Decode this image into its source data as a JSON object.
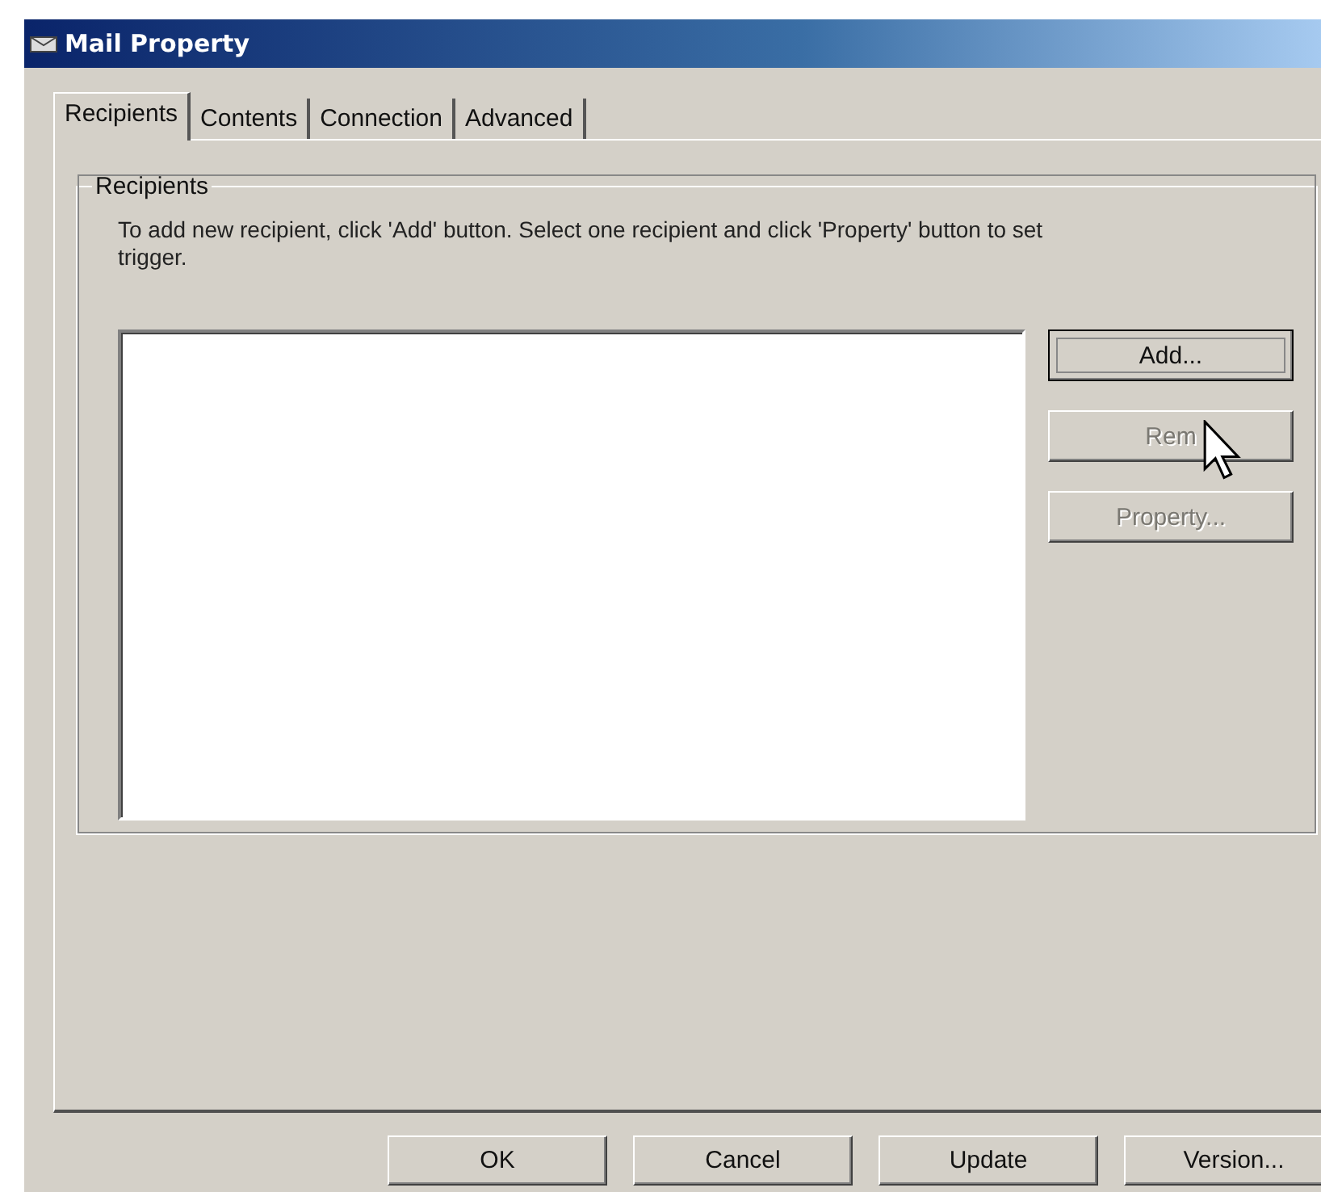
{
  "window": {
    "title": "Mail Property"
  },
  "tabs": [
    {
      "label": "Recipients",
      "selected": true
    },
    {
      "label": "Contents",
      "selected": false
    },
    {
      "label": "Connection",
      "selected": false
    },
    {
      "label": "Advanced",
      "selected": false
    }
  ],
  "group": {
    "title": "Recipients",
    "instructions": "To add new recipient, click 'Add' button. Select one recipient and click 'Property' button to set trigger."
  },
  "side_buttons": [
    {
      "label": "Add...",
      "disabled": false,
      "focused": true
    },
    {
      "label": "Rem",
      "disabled": true,
      "focused": false
    },
    {
      "label": "Property...",
      "disabled": true,
      "focused": false
    }
  ],
  "buttons": [
    {
      "label": "OK"
    },
    {
      "label": "Cancel"
    },
    {
      "label": "Update"
    },
    {
      "label": "Version..."
    }
  ]
}
